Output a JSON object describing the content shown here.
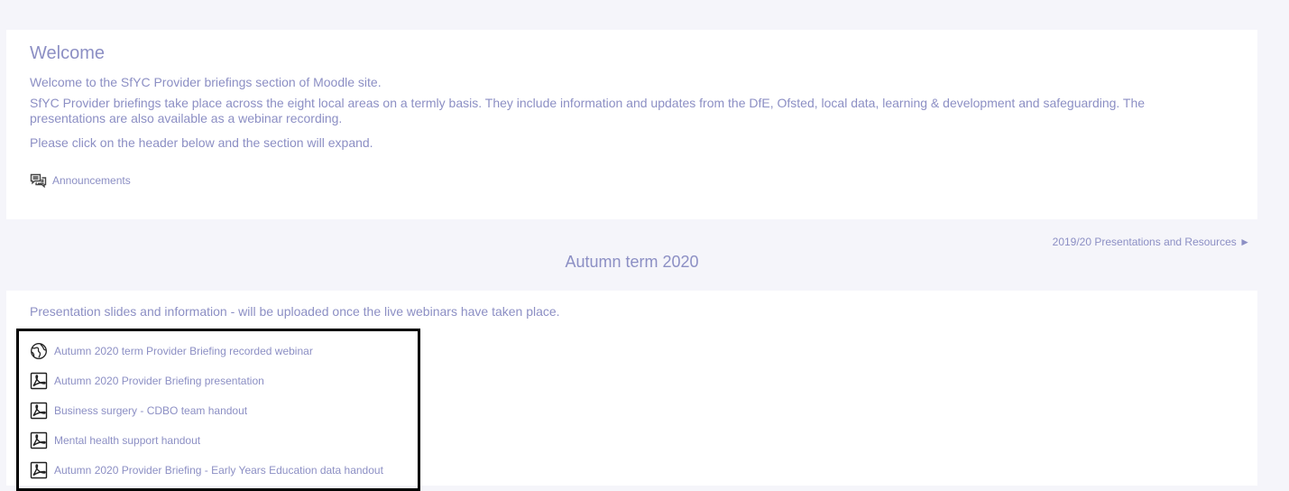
{
  "welcome": {
    "title": "Welcome",
    "paragraph1": "Welcome to the SfYC Provider briefings section of Moodle site.",
    "paragraph2": "SfYC Provider briefings take place across the eight local areas on a termly basis.  They include information and updates from the DfE, Ofsted, local data, learning & development and safeguarding. The presentations are also available as a webinar recording.",
    "paragraph3": "Please click on the header below and the section will expand.",
    "announcements_label": "Announcements",
    "announcements_icon": "forum-icon"
  },
  "section_nav": {
    "next_label": "2019/20 Presentations and Resources ►"
  },
  "autumn_section": {
    "title": "Autumn term 2020",
    "summary": "Presentation slides and information - will be uploaded once the live webinars have taken place.",
    "resources": [
      {
        "label": "Autumn 2020 term Provider Briefing recorded webinar",
        "icon": "globe-icon"
      },
      {
        "label": "Autumn 2020 Provider Briefing presentation",
        "icon": "pdf-icon"
      },
      {
        "label": "Business surgery - CDBO team handout",
        "icon": "pdf-icon"
      },
      {
        "label": "Mental health support handout",
        "icon": "pdf-icon"
      },
      {
        "label": "Autumn 2020 Provider Briefing - Early Years Education data handout",
        "icon": "pdf-icon"
      }
    ]
  },
  "colors": {
    "text": "#8c8fc4",
    "page_background": "#f5f5fa",
    "card_background": "#ffffff",
    "highlight_border": "#000000"
  }
}
